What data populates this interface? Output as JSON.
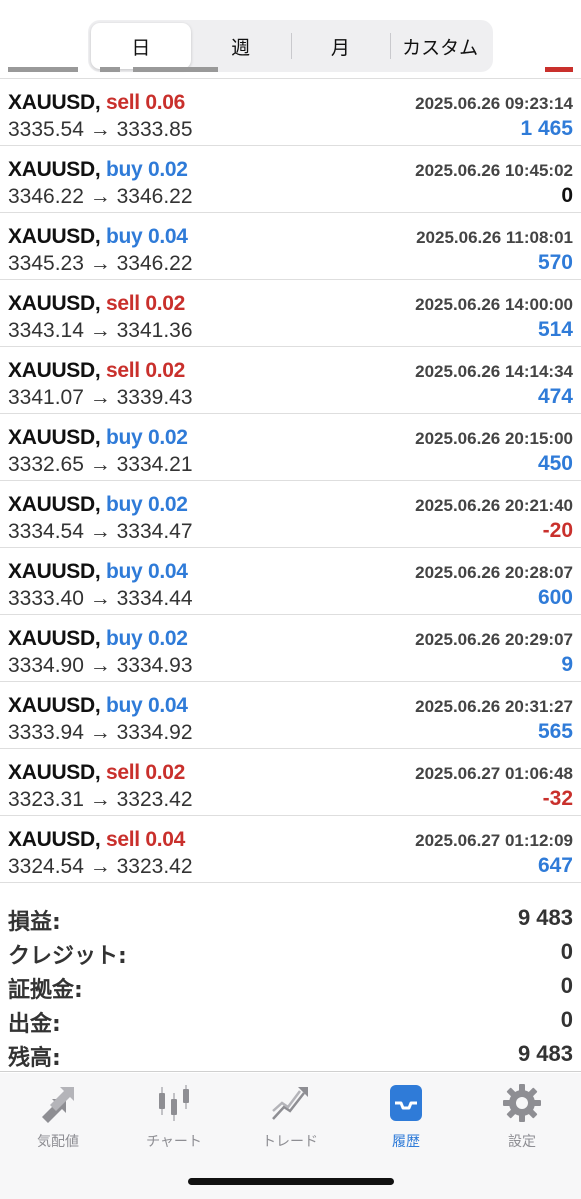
{
  "period_tabs": [
    {
      "label": "日",
      "active": true
    },
    {
      "label": "週",
      "active": false
    },
    {
      "label": "月",
      "active": false
    },
    {
      "label": "カスタム",
      "active": false
    }
  ],
  "deals": [
    {
      "symbol": "XAUUSD,",
      "side": "sell",
      "lots": "0.06",
      "time": "2025.06.26 09:23:14",
      "open": "3335.54",
      "close": "3333.85",
      "profit": "1 465",
      "profit_sign": "pos"
    },
    {
      "symbol": "XAUUSD,",
      "side": "buy",
      "lots": "0.02",
      "time": "2025.06.26 10:45:02",
      "open": "3346.22",
      "close": "3346.22",
      "profit": "0",
      "profit_sign": "zero"
    },
    {
      "symbol": "XAUUSD,",
      "side": "buy",
      "lots": "0.04",
      "time": "2025.06.26 11:08:01",
      "open": "3345.23",
      "close": "3346.22",
      "profit": "570",
      "profit_sign": "pos"
    },
    {
      "symbol": "XAUUSD,",
      "side": "sell",
      "lots": "0.02",
      "time": "2025.06.26 14:00:00",
      "open": "3343.14",
      "close": "3341.36",
      "profit": "514",
      "profit_sign": "pos"
    },
    {
      "symbol": "XAUUSD,",
      "side": "sell",
      "lots": "0.02",
      "time": "2025.06.26 14:14:34",
      "open": "3341.07",
      "close": "3339.43",
      "profit": "474",
      "profit_sign": "pos"
    },
    {
      "symbol": "XAUUSD,",
      "side": "buy",
      "lots": "0.02",
      "time": "2025.06.26 20:15:00",
      "open": "3332.65",
      "close": "3334.21",
      "profit": "450",
      "profit_sign": "pos"
    },
    {
      "symbol": "XAUUSD,",
      "side": "buy",
      "lots": "0.02",
      "time": "2025.06.26 20:21:40",
      "open": "3334.54",
      "close": "3334.47",
      "profit": "-20",
      "profit_sign": "neg"
    },
    {
      "symbol": "XAUUSD,",
      "side": "buy",
      "lots": "0.04",
      "time": "2025.06.26 20:28:07",
      "open": "3333.40",
      "close": "3334.44",
      "profit": "600",
      "profit_sign": "pos"
    },
    {
      "symbol": "XAUUSD,",
      "side": "buy",
      "lots": "0.02",
      "time": "2025.06.26 20:29:07",
      "open": "3334.90",
      "close": "3334.93",
      "profit": "9",
      "profit_sign": "pos"
    },
    {
      "symbol": "XAUUSD,",
      "side": "buy",
      "lots": "0.04",
      "time": "2025.06.26 20:31:27",
      "open": "3333.94",
      "close": "3334.92",
      "profit": "565",
      "profit_sign": "pos"
    },
    {
      "symbol": "XAUUSD,",
      "side": "sell",
      "lots": "0.02",
      "time": "2025.06.27 01:06:48",
      "open": "3323.31",
      "close": "3323.42",
      "profit": "-32",
      "profit_sign": "neg"
    },
    {
      "symbol": "XAUUSD,",
      "side": "sell",
      "lots": "0.04",
      "time": "2025.06.27 01:12:09",
      "open": "3324.54",
      "close": "3323.42",
      "profit": "647",
      "profit_sign": "pos"
    }
  ],
  "arrow": "→",
  "summary": [
    {
      "label": "損益:",
      "value": "9 483"
    },
    {
      "label": "クレジット:",
      "value": "0"
    },
    {
      "label": "証拠金:",
      "value": "0"
    },
    {
      "label": "出金:",
      "value": "0"
    },
    {
      "label": "残高:",
      "value": "9 483"
    }
  ],
  "tabbar": [
    {
      "label": "気配値",
      "icon": "quotes-arrows-icon",
      "active": false
    },
    {
      "label": "チャート",
      "icon": "candlestick-chart-icon",
      "active": false
    },
    {
      "label": "トレード",
      "icon": "trade-chart-icon",
      "active": false
    },
    {
      "label": "履歴",
      "icon": "history-tray-icon",
      "active": true
    },
    {
      "label": "設定",
      "icon": "gear-icon",
      "active": false
    }
  ],
  "colors": {
    "buy": "#2f7bd8",
    "sell": "#c9302c",
    "accent": "#2f7bd8"
  }
}
